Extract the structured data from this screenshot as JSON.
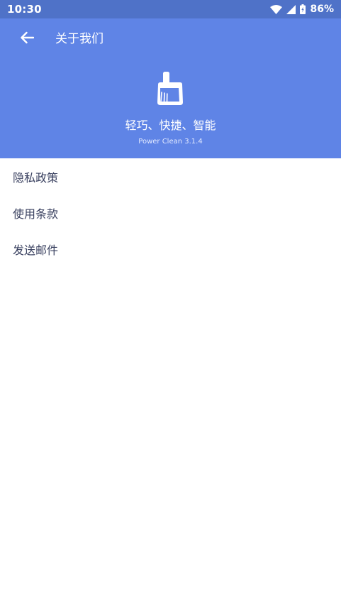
{
  "status_bar": {
    "time": "10:30",
    "battery_percent": "86%",
    "icons": [
      "wifi-icon",
      "signal-icon",
      "battery-icon"
    ]
  },
  "toolbar": {
    "title": "关于我们",
    "back_icon": "arrow-left-icon"
  },
  "app": {
    "logo_icon": "broom-icon",
    "slogan": "轻巧、快捷、智能",
    "version": "Power Clean 3.1.4"
  },
  "menu": {
    "items": [
      {
        "label": "隐私政策"
      },
      {
        "label": "使用条款"
      },
      {
        "label": "发送邮件"
      }
    ]
  },
  "colors": {
    "status_bar": "#4f72c8",
    "header": "#5f84e6",
    "menu_text": "#3a4160",
    "background": "#ffffff"
  }
}
